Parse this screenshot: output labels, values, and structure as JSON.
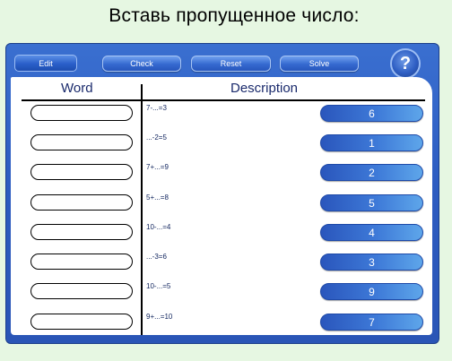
{
  "heading": "Вставь пропущенное число:",
  "toolbar": {
    "edit_label": "Edit",
    "check_label": "Check",
    "reset_label": "Reset",
    "solve_label": "Solve",
    "help_label": "?"
  },
  "columns": {
    "word": "Word",
    "description": "Description"
  },
  "rows": [
    {
      "description": "7-...=3",
      "number": "6"
    },
    {
      "description": "...-2=5",
      "number": "1"
    },
    {
      "description": "7+...=9",
      "number": "2"
    },
    {
      "description": "5+...=8",
      "number": "5"
    },
    {
      "description": "10-...=4",
      "number": "4"
    },
    {
      "description": "...-3=6",
      "number": "3"
    },
    {
      "description": "10-...=5",
      "number": "9"
    },
    {
      "description": "9+...=10",
      "number": "7"
    }
  ],
  "colors": {
    "background": "#e6f7e2",
    "frame": "#2c5bc0",
    "accent": "#3e7ad8"
  }
}
